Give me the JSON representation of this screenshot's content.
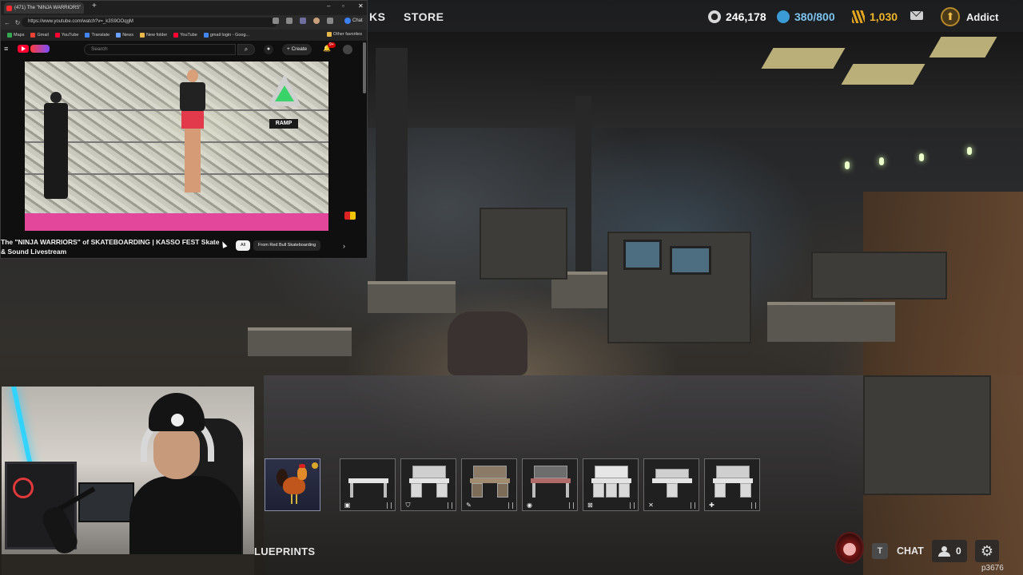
{
  "game": {
    "nav": {
      "left_partial": "KS",
      "store": "STORE"
    },
    "currencies": [
      {
        "name": "cod-points",
        "value": "246,178",
        "icon": "cod-points-icon",
        "color": "#d8d8d8"
      },
      {
        "name": "battle-pass-tokens",
        "value": "380/800",
        "icon": "token-icon",
        "color": "#3b9bd6"
      },
      {
        "name": "gold-currency",
        "value": "1,030",
        "icon": "gold-bars-icon",
        "color": "#e0a41f"
      }
    ],
    "player_name": "Addict",
    "blueprints_label": "LUEPRINTS",
    "chat_key": "T",
    "chat_label": "CHAT",
    "party_count": "0",
    "player_id": "p3676",
    "tray": [
      {
        "name": "rooster",
        "icon": ""
      },
      {
        "name": "bench-1",
        "icon": "▣"
      },
      {
        "name": "bench-2",
        "icon": "⛉"
      },
      {
        "name": "bench-3",
        "icon": "✎"
      },
      {
        "name": "bench-4",
        "icon": "◉"
      },
      {
        "name": "bench-5",
        "icon": "⊠"
      },
      {
        "name": "bench-6",
        "icon": "✕"
      },
      {
        "name": "bench-7",
        "icon": "✚"
      }
    ]
  },
  "browser": {
    "tab_title": "(471) The \"NINJA WARRIORS\"",
    "url": "https://www.youtube.com/watch?v=_k3S9OOqgM",
    "chat_label": "Chat",
    "bookmarks": [
      "Maps",
      "Gmail",
      "YouTube",
      "Translate",
      "News",
      "New folder",
      "YouTube",
      "gmail login - Goog..."
    ],
    "other_favorites": "Other favorites",
    "search_placeholder": "Search",
    "create_label": "Create",
    "notification_count": "9+",
    "ramp_label": "RAMP",
    "video_title": "The \"NINJA WARRIORS\" of SKATEBOARDING | KASSO FEST Skate & Sound Livestream",
    "chips": {
      "all": "All",
      "from": "From Red Bull Skateboarding"
    }
  }
}
